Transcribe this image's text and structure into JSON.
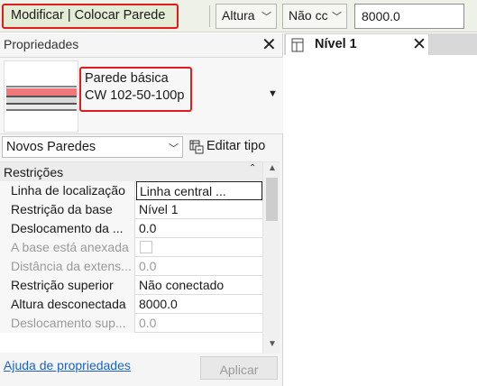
{
  "options_bar": {
    "context_label": "Modificar | Colocar Parede",
    "height_mode": "Altura",
    "constraint": "Não cc",
    "height_value": "8000.0"
  },
  "properties": {
    "title": "Propriedades",
    "type_name_line1": "Parede básica",
    "type_name_line2": "CW 102-50-100p",
    "instance_filter": "Novos Paredes",
    "edit_type_label": "Editar tipo",
    "category": "Restrições",
    "rows": [
      {
        "name": "Linha de localização",
        "value": "Linha central ..."
      },
      {
        "name": "Restrição da base",
        "value": "Nível 1"
      },
      {
        "name": "Deslocamento da ...",
        "value": "0.0"
      },
      {
        "name": "A base está anexada",
        "value": ""
      },
      {
        "name": "Distância da extens...",
        "value": "0.0"
      },
      {
        "name": "Restrição superior",
        "value": "Não conectado"
      },
      {
        "name": "Altura desconectada",
        "value": "8000.0"
      },
      {
        "name": "Deslocamento sup...",
        "value": "0.0"
      }
    ],
    "help_link": "Ajuda de propriedades",
    "apply_button": "Aplicar"
  },
  "view_tab": {
    "label": "Nível 1"
  },
  "colors": {
    "highlight_border": "#e01b1b",
    "link": "#1a62c9",
    "context_tab_bg": "#e4ecd6"
  }
}
